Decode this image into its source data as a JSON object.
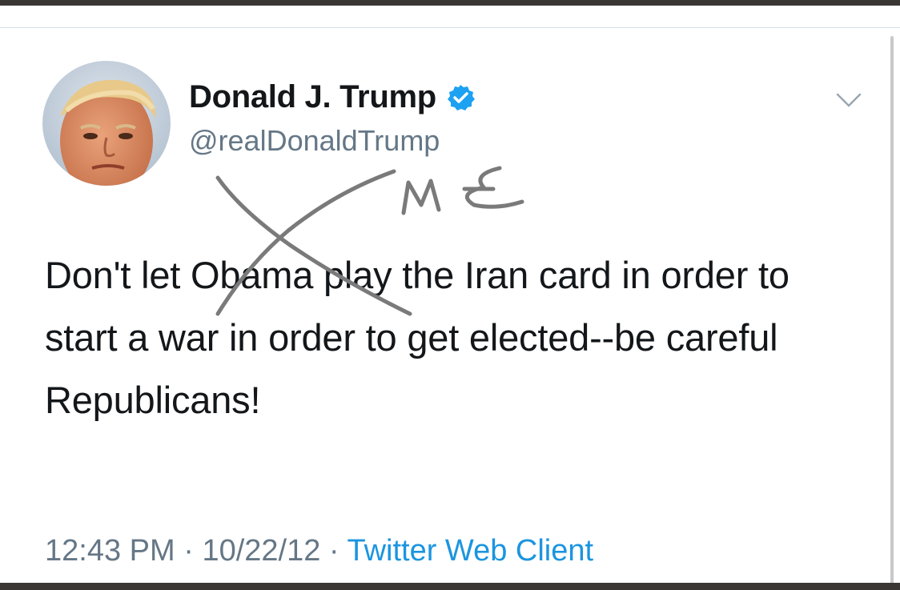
{
  "tweet": {
    "display_name": "Donald J. Trump",
    "handle": "@realDonaldTrump",
    "text": "Don't let Obama play the Iran card in order to start a war in order to get elected--be careful Republicans!",
    "time": "12:43 PM",
    "date": "10/22/12",
    "client": "Twitter Web Client",
    "separator": "·"
  },
  "annotation": {
    "handwritten_text": "ME"
  },
  "icons": {
    "verified": "verified-badge-icon",
    "menu": "chevron-down-icon"
  },
  "colors": {
    "name": "#14171a",
    "secondary": "#657786",
    "link": "#1b95e0",
    "verified": "#1da1f2",
    "scribble": "#7a7a7a"
  }
}
